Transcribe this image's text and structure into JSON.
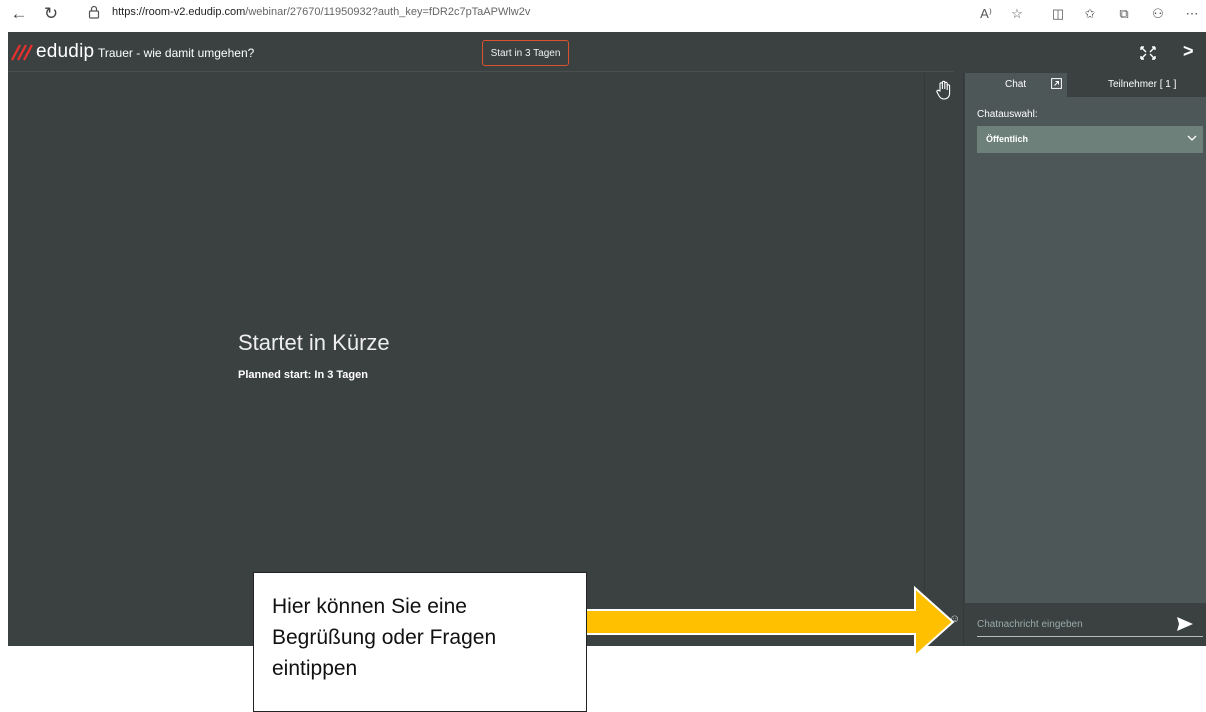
{
  "browser": {
    "url_host": "https://room-v2.edudip.com",
    "url_path": "/webinar/27670/11950932?auth_key=fDR2c7pTaAPWlw2v",
    "read_aloud": "A⁾"
  },
  "app": {
    "brand": "edudip",
    "webinar_title": "Trauer - wie damit umgehen?",
    "start_button": "Start in 3 Tagen"
  },
  "stage": {
    "heading": "Startet in Kürze",
    "planned_start": "Planned start: In 3 Tagen"
  },
  "chat": {
    "tab_chat": "Chat",
    "tab_participants": "Teilnehmer [ 1 ]",
    "select_label": "Chatauswahl:",
    "select_value": "Öffentlich",
    "input_placeholder": "Chatnachricht eingeben"
  },
  "annotation": {
    "line1": "Hier können Sie eine",
    "line2": "Begrüßung oder Fragen",
    "line3": "eintippen",
    "arrow_color": "#ffc000"
  },
  "colors": {
    "brand_red": "#e8312f",
    "background": "#3b4141",
    "accent_orange": "#d9532c"
  }
}
